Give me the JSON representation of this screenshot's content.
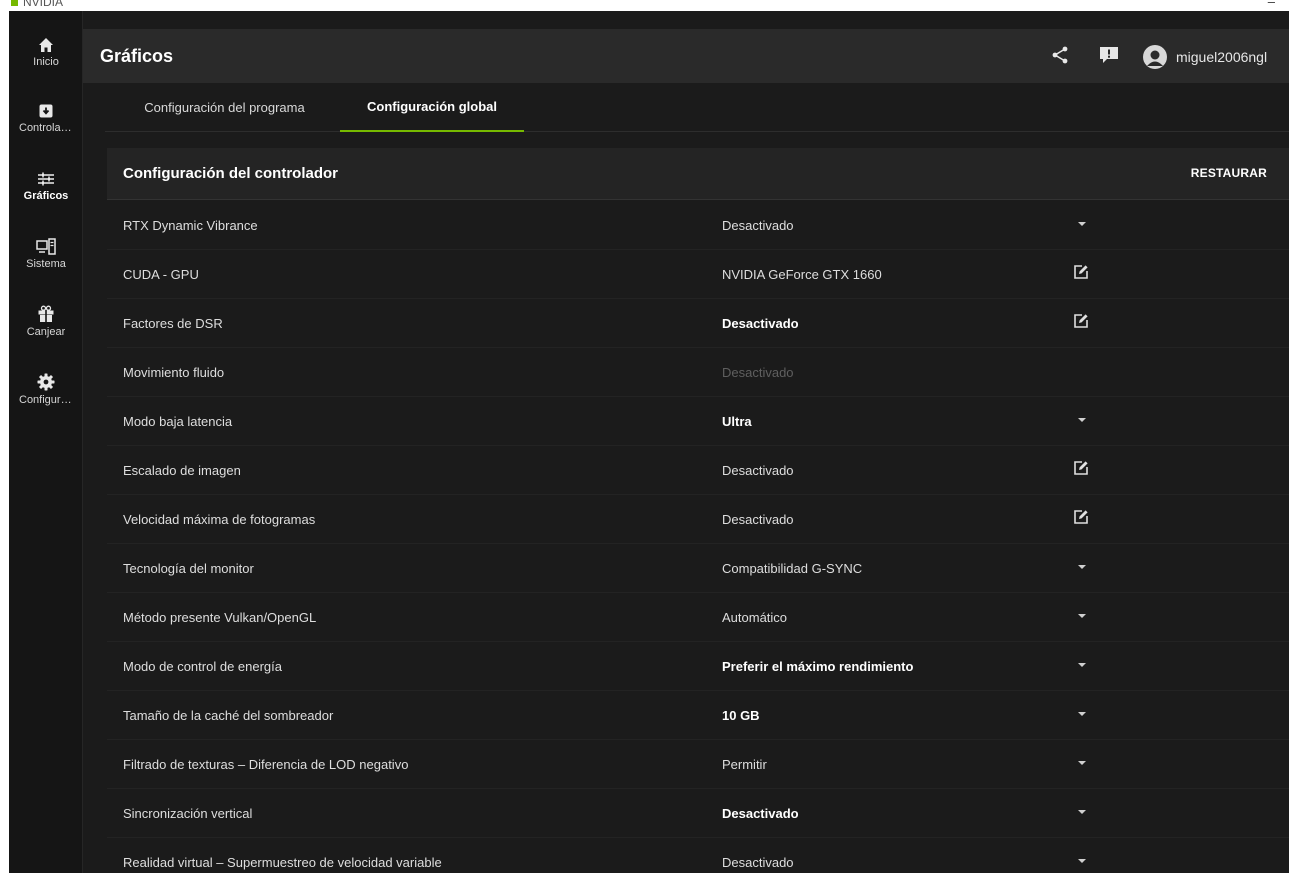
{
  "window": {
    "app_name": "NVIDIA",
    "minimize_glyph": "–"
  },
  "sidebar": {
    "items": [
      {
        "label": "Inicio",
        "icon": "home-icon",
        "active": false
      },
      {
        "label": "Controladores",
        "icon": "driver-download-icon",
        "active": false
      },
      {
        "label": "Gráficos",
        "icon": "graphics-sliders-icon",
        "active": true
      },
      {
        "label": "Sistema",
        "icon": "system-monitor-icon",
        "active": false
      },
      {
        "label": "Canjear",
        "icon": "gift-icon",
        "active": false
      },
      {
        "label": "Configuración",
        "icon": "gear-icon",
        "active": false
      }
    ]
  },
  "header": {
    "title": "Gráficos",
    "icons": [
      "share-icon",
      "feedback-icon",
      "avatar-icon"
    ],
    "username": "miguel2006ngl"
  },
  "tabs": [
    {
      "label": "Configuración del programa",
      "active": false
    },
    {
      "label": "Configuración global",
      "active": true
    }
  ],
  "section": {
    "title": "Configuración del controlador",
    "restore_label": "RESTAURAR"
  },
  "settings": [
    {
      "label": "RTX Dynamic Vibrance",
      "value": "Desactivado",
      "style": "normal",
      "control": "dropdown"
    },
    {
      "label": "CUDA - GPU",
      "value": "NVIDIA GeForce GTX 1660",
      "style": "normal",
      "control": "edit"
    },
    {
      "label": "Factores de DSR",
      "value": "Desactivado",
      "style": "bold",
      "control": "edit"
    },
    {
      "label": "Movimiento fluido",
      "value": "Desactivado",
      "style": "disabled",
      "control": "none"
    },
    {
      "label": "Modo baja latencia",
      "value": "Ultra",
      "style": "bold",
      "control": "dropdown"
    },
    {
      "label": "Escalado de imagen",
      "value": "Desactivado",
      "style": "normal",
      "control": "edit"
    },
    {
      "label": "Velocidad máxima de fotogramas",
      "value": "Desactivado",
      "style": "normal",
      "control": "edit"
    },
    {
      "label": "Tecnología del monitor",
      "value": "Compatibilidad G-SYNC",
      "style": "normal",
      "control": "dropdown"
    },
    {
      "label": "Método presente Vulkan/OpenGL",
      "value": "Automático",
      "style": "normal",
      "control": "dropdown"
    },
    {
      "label": "Modo de control de energía",
      "value": "Preferir el máximo rendimiento",
      "style": "bold",
      "control": "dropdown"
    },
    {
      "label": "Tamaño de la caché del sombreador",
      "value": "10 GB",
      "style": "bold",
      "control": "dropdown"
    },
    {
      "label": "Filtrado de texturas – Diferencia de LOD negativo",
      "value": "Permitir",
      "style": "normal",
      "control": "dropdown"
    },
    {
      "label": "Sincronización vertical",
      "value": "Desactivado",
      "style": "bold",
      "control": "dropdown"
    },
    {
      "label": "Realidad virtual – Supermuestreo de velocidad variable",
      "value": "Desactivado",
      "style": "normal",
      "control": "dropdown"
    }
  ],
  "colors": {
    "accent": "#76b900",
    "background": "#1b1b1b",
    "header": "#2a2a2a",
    "sidebar": "#151515"
  }
}
